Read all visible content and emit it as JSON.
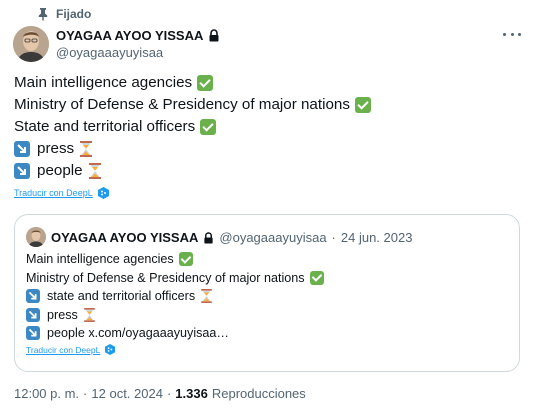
{
  "pinned": {
    "label": "Fijado",
    "icon": "pin-icon"
  },
  "tweet": {
    "author_name": "OYAGAA AYOO YISSAA",
    "author_handle": "@oyagaaayuyisaa",
    "protected_icon": "lock-icon",
    "more_icon": "more-dots-icon",
    "lines": [
      {
        "text": "Main intelligence agencies",
        "status": "check"
      },
      {
        "text": "Ministry of Defense & Presidency of major nations",
        "status": "check"
      },
      {
        "text": "State and territorial officers",
        "status": "check"
      },
      {
        "text": "press",
        "status": "hourglass",
        "prefix": "arrow"
      },
      {
        "text": "people",
        "status": "hourglass",
        "prefix": "arrow"
      }
    ],
    "translate_label": "Traducir con DeepL",
    "translate_icon": "deepl-icon"
  },
  "quoted": {
    "author_name": "OYAGAA AYOO YISSAA",
    "author_handle": "@oyagaaayuyisaa",
    "separator": "·",
    "date": "24 jun. 2023",
    "lines": [
      {
        "text": "Main intelligence agencies",
        "status": "check"
      },
      {
        "text": "Ministry of Defense & Presidency of major nations",
        "status": "check"
      },
      {
        "text": "state and territorial officers",
        "status": "hourglass",
        "prefix": "arrow"
      },
      {
        "text": "press",
        "status": "hourglass",
        "prefix": "arrow"
      },
      {
        "text": "people x.com/oyagaaayuyisaa…",
        "prefix": "arrow"
      }
    ],
    "translate_label": "Traducir con DeepL"
  },
  "meta": {
    "time": "12:00 p. m.",
    "separator": "·",
    "date": "12 oct. 2024",
    "separator2": "·",
    "views_count": "1.336",
    "views_label": "Reproducciones"
  },
  "colors": {
    "check_green": "#6ab04c",
    "arrow_blue": "#3b88c3",
    "link_blue": "#1d9bf0",
    "secondary_text": "#536471",
    "border": "#cfd9de"
  }
}
